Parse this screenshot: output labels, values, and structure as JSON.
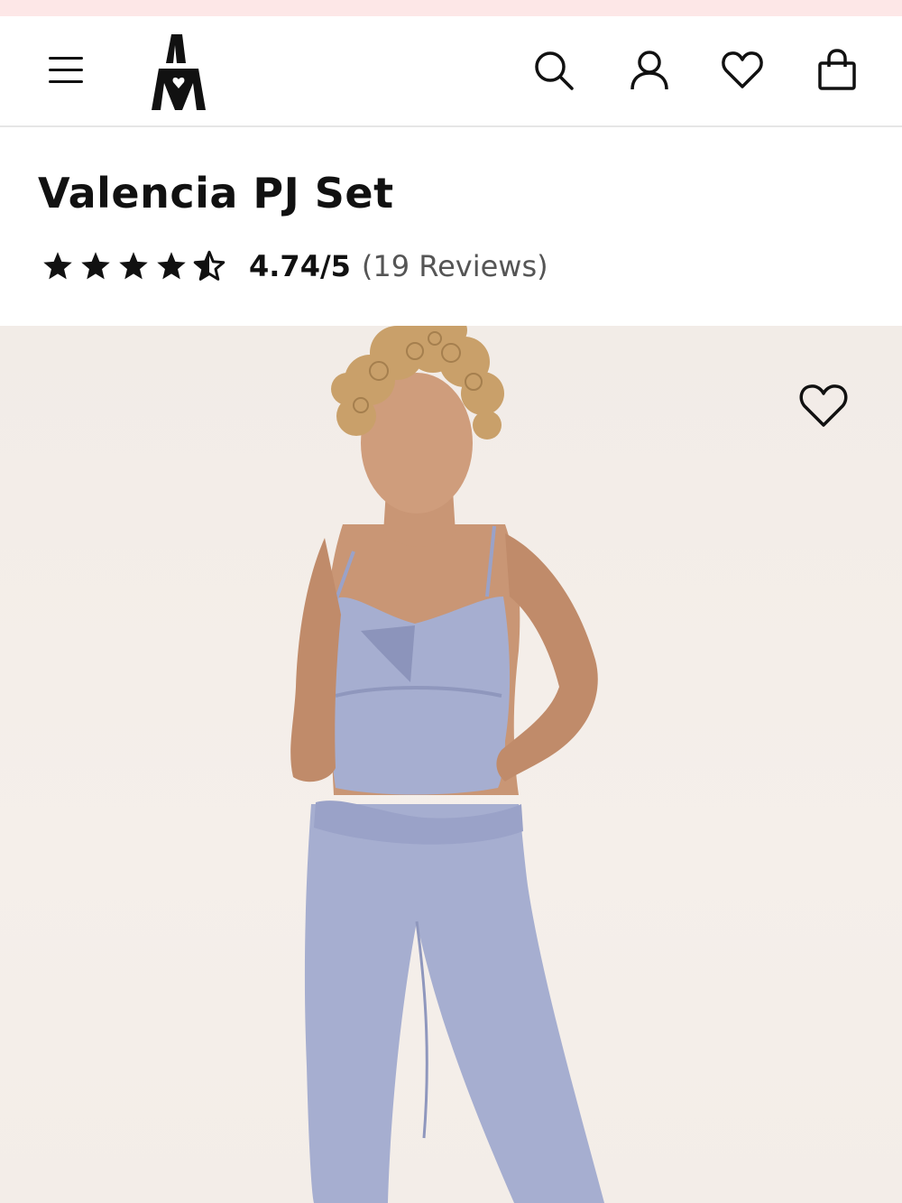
{
  "header": {
    "menu_icon": "hamburger-menu-icon",
    "logo_icon": "am-logo-icon",
    "icons": [
      "search-icon",
      "account-icon",
      "heart-icon",
      "shopping-bag-icon"
    ]
  },
  "product": {
    "title": "Valencia PJ Set",
    "rating_value": "4.74/5",
    "review_count": "(19 Reviews)",
    "rating_stars": 4.74
  },
  "hero": {
    "image": "model-wearing-lavender-pj-set-photo",
    "wishlist_icon": "heart-outline-icon"
  },
  "colors": {
    "promo_strip": "#fde7e7",
    "garment": "#a6aed0",
    "background": "#f2ece7"
  }
}
